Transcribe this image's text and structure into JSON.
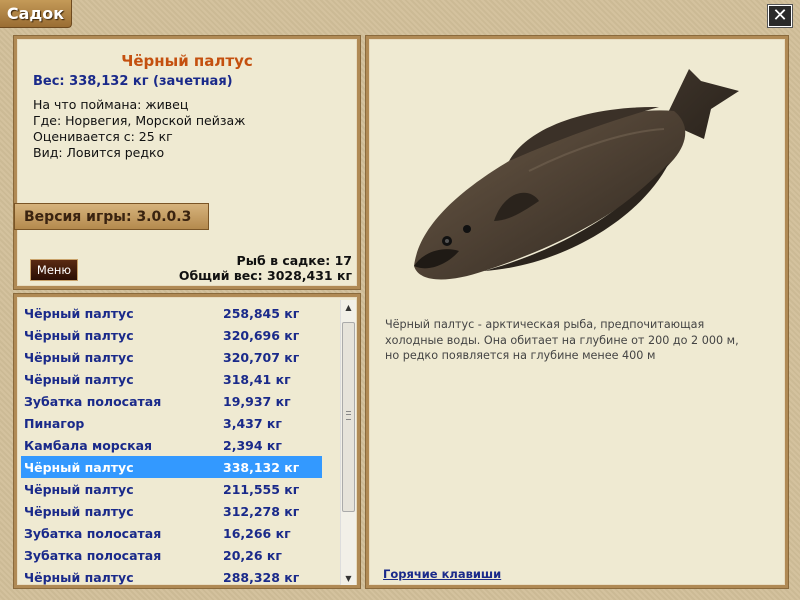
{
  "window": {
    "title": "Садок",
    "close_glyph": "✕",
    "close_icon": "close-icon"
  },
  "info": {
    "fish_name": "Чёрный палтус",
    "weight_line": "Вес: 338,132 кг (зачетная)",
    "details": [
      "На что поймана: живец",
      "Где: Норвегия, Морской пейзаж",
      "Оценивается с: 25 кг",
      "Вид: Ловится редко"
    ],
    "version": "Версия игры: 3.0.0.3",
    "menu_label": "Меню",
    "fish_count": "Рыб в садке: 17",
    "total_weight": "Общий вес: 3028,431 кг"
  },
  "catch_list": [
    {
      "name": "Чёрный палтус",
      "weight": "258,845 кг"
    },
    {
      "name": "Чёрный палтус",
      "weight": "320,696 кг"
    },
    {
      "name": "Чёрный палтус",
      "weight": "320,707 кг"
    },
    {
      "name": "Чёрный палтус",
      "weight": "318,41 кг"
    },
    {
      "name": "Зубатка полосатая",
      "weight": "19,937 кг"
    },
    {
      "name": "Пинагор",
      "weight": "3,437 кг"
    },
    {
      "name": "Камбала морская",
      "weight": "2,394 кг"
    },
    {
      "name": "Чёрный палтус",
      "weight": "338,132 кг",
      "selected": true
    },
    {
      "name": "Чёрный палтус",
      "weight": "211,555 кг"
    },
    {
      "name": "Чёрный палтус",
      "weight": "312,278 кг"
    },
    {
      "name": "Зубатка полосатая",
      "weight": "16,266 кг"
    },
    {
      "name": "Зубатка полосатая",
      "weight": "20,26 кг"
    },
    {
      "name": "Чёрный палтус",
      "weight": "288,328 кг"
    }
  ],
  "scrollbar": {
    "up_glyph": "▲",
    "down_glyph": "▼"
  },
  "detail": {
    "image_icon": "halibut-fish-image",
    "description": "Чёрный палтус - арктическая рыба, предпочитающая холодные воды. Она обитает на глубине от 200 до 2 000 м, но редко появляется на глубине менее 400 м",
    "hotkeys_link": "Горячие клавиши"
  },
  "colors": {
    "accent_title": "#c4500f",
    "list_text": "#1a2a8a",
    "selection": "#3399ff",
    "panel_bg": "#efead2",
    "frame": "#b08a55"
  }
}
